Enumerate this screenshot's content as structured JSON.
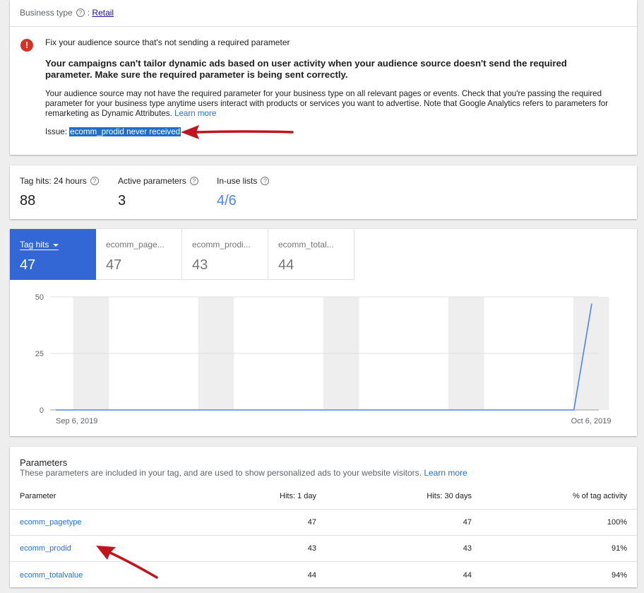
{
  "business": {
    "label": "Business type",
    "value": "Retail"
  },
  "issue": {
    "heading": "Fix your audience source that's not sending a required parameter",
    "bold_text": "Your campaigns can't tailor dynamic ads based on user activity when your audience source doesn't send the required parameter. Make sure the required parameter is being sent correctly.",
    "body": "Your audience source may not have the required parameter for your business type on all relevant pages or events. Check that you're passing the required parameter for your business type anytime users interact with products or services you want to advertise. Note that Google Analytics refers to parameters for remarketing as Dynamic Attributes.",
    "learn_more": "Learn more",
    "issue_label": "Issue:",
    "issue_value": "ecomm_prodid never received"
  },
  "stats": [
    {
      "label": "Tag hits: 24 hours",
      "value": "88"
    },
    {
      "label": "Active parameters",
      "value": "3"
    },
    {
      "label": "In-use lists",
      "value": "4/6"
    }
  ],
  "tabs": [
    {
      "label": "Tag hits",
      "value": "47"
    },
    {
      "label": "ecomm_page...",
      "value": "47"
    },
    {
      "label": "ecomm_prodi...",
      "value": "43"
    },
    {
      "label": "ecomm_total...",
      "value": "44"
    }
  ],
  "chart_data": {
    "type": "line",
    "x_start_label": "Sep 6, 2019",
    "x_end_label": "Oct 6, 2019",
    "y_ticks": [
      0,
      25,
      50
    ],
    "ylim": [
      0,
      50
    ],
    "days": 31,
    "series": [
      {
        "values": [
          0,
          0,
          0,
          0,
          0,
          0,
          0,
          0,
          0,
          0,
          0,
          0,
          0,
          0,
          0,
          0,
          0,
          0,
          0,
          0,
          0,
          0,
          0,
          0,
          0,
          0,
          0,
          0,
          0,
          0,
          47
        ]
      }
    ],
    "color": "#4a86e8",
    "weekend_shading": true
  },
  "params": {
    "title": "Parameters",
    "subtitle": "These parameters are included in your tag, and are used to show personalized ads to your website visitors.",
    "learn_more": "Learn more",
    "columns": [
      "Parameter",
      "Hits: 1 day",
      "Hits: 30 days",
      "% of tag activity"
    ],
    "rows": [
      {
        "name": "ecomm_pagetype",
        "hits_1d": "47",
        "hits_30d": "47",
        "pct": "100%"
      },
      {
        "name": "ecomm_prodid",
        "hits_1d": "43",
        "hits_30d": "43",
        "pct": "91%"
      },
      {
        "name": "ecomm_totalvalue",
        "hits_1d": "44",
        "hits_30d": "44",
        "pct": "94%"
      }
    ]
  }
}
